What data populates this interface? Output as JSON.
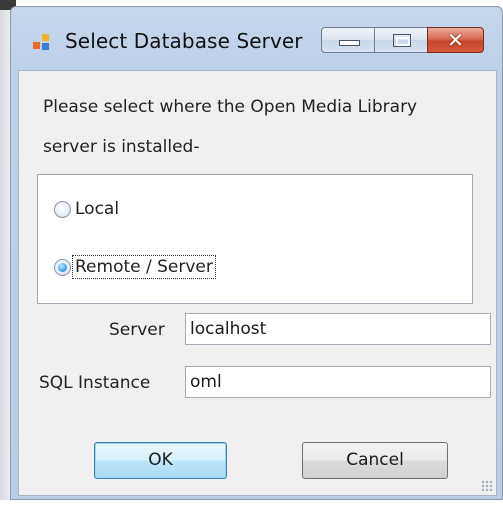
{
  "window": {
    "title": "Select Database Server",
    "close_glyph": "✕"
  },
  "prompt": {
    "line1": "Please select where the Open Media Library",
    "line2": "server is installed-"
  },
  "install_location": {
    "options": [
      {
        "label": "Local",
        "checked": false
      },
      {
        "label": "Remote / Server",
        "checked": true
      }
    ]
  },
  "fields": {
    "server_label": "Server",
    "server_value": "localhost",
    "instance_label": "SQL Instance",
    "instance_value": "oml"
  },
  "buttons": {
    "ok": "OK",
    "cancel": "Cancel"
  },
  "colors": {
    "title_bar": "#bcd0e9",
    "close_button": "#c7452a",
    "radio_selected": "#4aa8ec"
  },
  "icons": {
    "app": "database-server-icon",
    "minimize": "minimize-icon",
    "maximize": "maximize-icon",
    "close": "close-icon",
    "size_grip": "resize-grip-icon"
  }
}
